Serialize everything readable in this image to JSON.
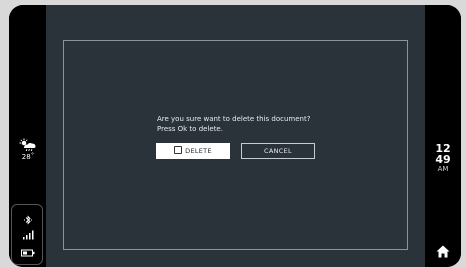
{
  "dialog": {
    "message_line1": "Are you sure want to delete this document?",
    "message_line2": "Press Ok to delete.",
    "delete_label": "DELETE",
    "cancel_label": "CANCEL"
  },
  "status": {
    "weather_icon": "sun-cloud-rain-icon",
    "temperature": "28˚",
    "bluetooth_icon": "bluetooth-icon",
    "signal_icon": "signal-bars-icon",
    "battery_icon": "battery-icon"
  },
  "clock": {
    "hour": "12",
    "minute": "49",
    "ampm": "AM"
  },
  "nav": {
    "home_icon": "home-icon"
  },
  "colors": {
    "screen_bg": "#2a323a",
    "frame": "#000000",
    "button_bg": "#ffffff"
  }
}
